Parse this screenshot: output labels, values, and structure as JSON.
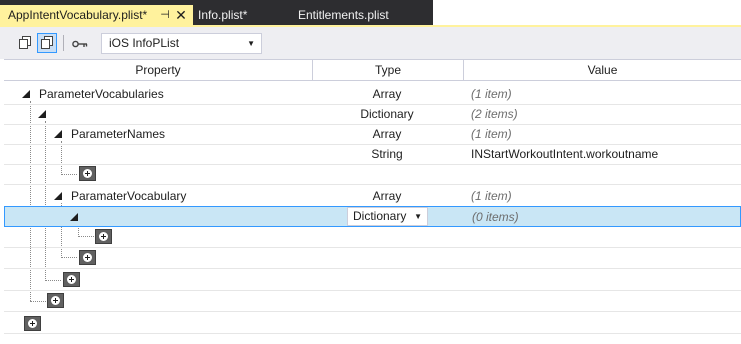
{
  "tabs": {
    "active_label": "AppIntentVocabulary.plist*",
    "pin_glyph": "⊣",
    "close_glyph": "✕",
    "inactive": [
      "Info.plist*",
      "Entitlements.plist"
    ]
  },
  "toolbar": {
    "schema_value": "iOS InfoPList"
  },
  "columns": {
    "property": "Property",
    "type": "Type",
    "value": "Value"
  },
  "rows": [
    {
      "property": "ParameterVocabularies",
      "type": "Array",
      "value": "(1 item)"
    },
    {
      "property": "",
      "type": "Dictionary",
      "value": "(2 items)"
    },
    {
      "property": "ParameterNames",
      "type": "Array",
      "value": "(1 item)"
    },
    {
      "property": "",
      "type": "String",
      "value": "INStartWorkoutIntent.workoutname"
    },
    {
      "property": "",
      "type": "",
      "value": ""
    },
    {
      "property": "ParamaterVocabulary",
      "type": "Array",
      "value": "(1 item)"
    },
    {
      "property": "",
      "type": "Dictionary",
      "value": "(0 items)"
    }
  ],
  "colors": {
    "tab_active": "#fff29d",
    "tab_strip": "#2d2d30",
    "selection": "#c9e6f5",
    "selection_border": "#3399ff"
  }
}
